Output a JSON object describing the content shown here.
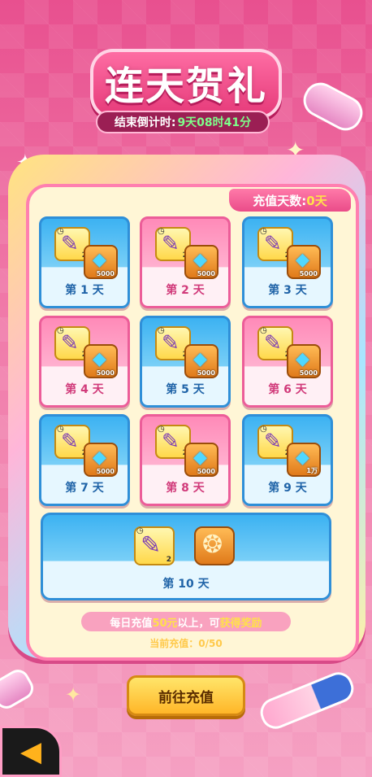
{
  "header": {
    "title": "连天贺礼",
    "countdown_label": "结束倒计时:",
    "countdown_value": "9天08时41分"
  },
  "charge_days": {
    "label": "充值天数:",
    "value": "0天"
  },
  "days": [
    {
      "label": "第 1 天",
      "brush_qty": "2",
      "gem_qty": "5000",
      "theme": "blue"
    },
    {
      "label": "第 2 天",
      "brush_qty": "2",
      "gem_qty": "5000",
      "theme": "pink"
    },
    {
      "label": "第 3 天",
      "brush_qty": "2",
      "gem_qty": "5000",
      "theme": "blue"
    },
    {
      "label": "第 4 天",
      "brush_qty": "2",
      "gem_qty": "5000",
      "theme": "pink"
    },
    {
      "label": "第 5 天",
      "brush_qty": "2",
      "gem_qty": "5000",
      "theme": "blue"
    },
    {
      "label": "第 6 天",
      "brush_qty": "2",
      "gem_qty": "5000",
      "theme": "pink"
    },
    {
      "label": "第 7 天",
      "brush_qty": "2",
      "gem_qty": "5000",
      "theme": "blue"
    },
    {
      "label": "第 8 天",
      "brush_qty": "2",
      "gem_qty": "5000",
      "theme": "pink"
    },
    {
      "label": "第 9 天",
      "brush_qty": "2",
      "gem_qty": "1万",
      "theme": "blue"
    }
  ],
  "day10": {
    "label": "第 10 天",
    "brush_qty": "2"
  },
  "tip": {
    "part1": "每日充值",
    "amount": "50元",
    "part2": "以上，可",
    "reward": "获得奖励"
  },
  "progress": "当前充值：0/50",
  "go_button": "前往充值",
  "icons": {
    "brush": "paintbrush-icon",
    "gem": "diamond-icon",
    "ring": "ring-frame-icon",
    "back": "back-arrow-icon"
  }
}
